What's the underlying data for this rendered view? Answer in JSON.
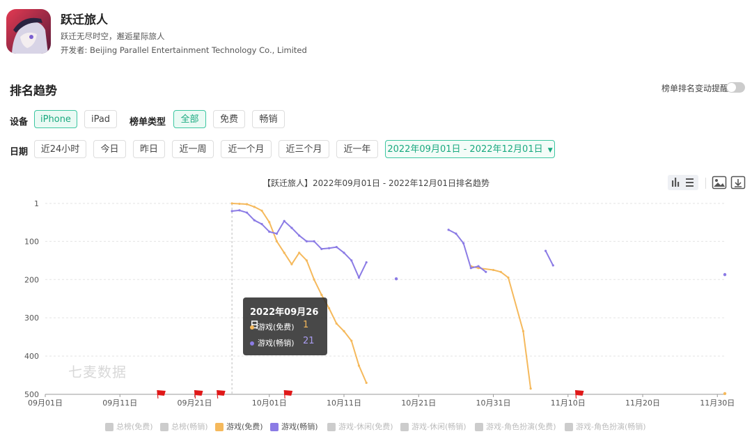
{
  "app": {
    "name": "跃迁旅人",
    "subtitle": "跃迁无尽时空，邂逅星际旅人",
    "developer": "开发者: Beijing Parallel Entertainment Technology Co., Limited"
  },
  "section": {
    "title": "排名趋势",
    "alert_label": "榜单排名变动提醒",
    "alert_on": false
  },
  "filters": {
    "device_label": "设备",
    "devices": [
      {
        "label": "iPhone",
        "active": true
      },
      {
        "label": "iPad",
        "active": false
      }
    ],
    "chart_type_label": "榜单类型",
    "chart_types": [
      {
        "label": "全部",
        "active": true
      },
      {
        "label": "免费",
        "active": false
      },
      {
        "label": "畅销",
        "active": false
      }
    ],
    "date_label": "日期",
    "dates": [
      "近24小时",
      "今日",
      "昨日",
      "近一周",
      "近一个月",
      "近三个月",
      "近一年"
    ],
    "date_range": "2022年09月01日 - 2022年12月01日"
  },
  "toolbar_icons": [
    "bar-chart-icon",
    "list-icon",
    "image-icon",
    "download-icon"
  ],
  "chart_data": {
    "type": "line",
    "title": "【跃迁旅人】2022年09月01日 - 2022年12月01日排名趋势",
    "x_tick_labels": [
      "09月01日",
      "09月11日",
      "09月21日",
      "10月01日",
      "10月11日",
      "10月21日",
      "10月31日",
      "11月10日",
      "11月20日",
      "11月30日"
    ],
    "xlim": [
      "2022-09-01",
      "2022-12-01"
    ],
    "y_tick_labels": [
      "1",
      "100",
      "200",
      "300",
      "400",
      "500"
    ],
    "y_ticks": [
      1,
      100,
      200,
      300,
      400,
      500
    ],
    "ylim": [
      1,
      500
    ],
    "y_inverted": true,
    "grid": true,
    "legend_position": "bottom",
    "series": [
      {
        "name": "游戏(免费)",
        "color": "#f5b95c",
        "segments": [
          [
            [
              "2022-09-26",
              1
            ],
            [
              "2022-09-27",
              2
            ],
            [
              "2022-09-28",
              3
            ],
            [
              "2022-09-29",
              10
            ],
            [
              "2022-09-30",
              20
            ],
            [
              "2022-10-01",
              50
            ],
            [
              "2022-10-02",
              100
            ],
            [
              "2022-10-03",
              130
            ],
            [
              "2022-10-04",
              160
            ],
            [
              "2022-10-05",
              130
            ],
            [
              "2022-10-06",
              150
            ],
            [
              "2022-10-07",
              200
            ],
            [
              "2022-10-08",
              240
            ],
            [
              "2022-10-09",
              275
            ],
            [
              "2022-10-10",
              315
            ],
            [
              "2022-10-11",
              335
            ],
            [
              "2022-10-12",
              360
            ],
            [
              "2022-10-13",
              425
            ],
            [
              "2022-10-14",
              470
            ]
          ],
          [
            [
              "2022-10-28",
              165
            ],
            [
              "2022-10-29",
              170
            ],
            [
              "2022-10-31",
              175
            ],
            [
              "2022-11-01",
              180
            ],
            [
              "2022-11-02",
              195
            ],
            [
              "2022-11-04",
              335
            ],
            [
              "2022-11-05",
              485
            ]
          ],
          [
            [
              "2022-12-01",
              498
            ]
          ]
        ]
      },
      {
        "name": "游戏(畅销)",
        "color": "#8b7be5",
        "segments": [
          [
            [
              "2022-09-26",
              21
            ],
            [
              "2022-09-27",
              19
            ],
            [
              "2022-09-28",
              25
            ],
            [
              "2022-09-29",
              45
            ],
            [
              "2022-09-30",
              55
            ],
            [
              "2022-10-01",
              75
            ],
            [
              "2022-10-02",
              80
            ],
            [
              "2022-10-03",
              47
            ],
            [
              "2022-10-04",
              65
            ],
            [
              "2022-10-05",
              85
            ],
            [
              "2022-10-06",
              100
            ],
            [
              "2022-10-07",
              100
            ],
            [
              "2022-10-08",
              120
            ],
            [
              "2022-10-09",
              118
            ],
            [
              "2022-10-10",
              115
            ],
            [
              "2022-10-11",
              130
            ],
            [
              "2022-10-12",
              150
            ],
            [
              "2022-10-13",
              195
            ],
            [
              "2022-10-14",
              155
            ]
          ],
          [
            [
              "2022-10-18",
              198
            ]
          ],
          [
            [
              "2022-10-25",
              70
            ],
            [
              "2022-10-26",
              80
            ],
            [
              "2022-10-27",
              105
            ],
            [
              "2022-10-28",
              170
            ],
            [
              "2022-10-29",
              165
            ],
            [
              "2022-10-30",
              180
            ]
          ],
          [
            [
              "2022-11-07",
              125
            ],
            [
              "2022-11-08",
              163
            ]
          ],
          [
            [
              "2022-12-01",
              187
            ]
          ]
        ]
      }
    ],
    "flag_dates": [
      "2022-09-16",
      "2022-09-21",
      "2022-09-24",
      "2022-10-03",
      "2022-11-11"
    ],
    "hover_date": "2022-09-26",
    "tooltip": {
      "date": "2022年09月26日",
      "rows": [
        {
          "name": "游戏(免费)",
          "value": "1",
          "color": "#f5b95c"
        },
        {
          "name": "游戏(畅销)",
          "value": "21",
          "color": "#8b7be5"
        }
      ]
    },
    "legend": [
      {
        "name": "总榜(免费)",
        "active": false,
        "color": "#cccccc"
      },
      {
        "name": "总榜(畅销)",
        "active": false,
        "color": "#cccccc"
      },
      {
        "name": "游戏(免费)",
        "active": true,
        "color": "#f5b95c"
      },
      {
        "name": "游戏(畅销)",
        "active": true,
        "color": "#8b7be5"
      },
      {
        "name": "游戏-休闲(免费)",
        "active": false,
        "color": "#cccccc"
      },
      {
        "name": "游戏-休闲(畅销)",
        "active": false,
        "color": "#cccccc"
      },
      {
        "name": "游戏-角色扮演(免费)",
        "active": false,
        "color": "#cccccc"
      },
      {
        "name": "游戏-角色扮演(畅销)",
        "active": false,
        "color": "#cccccc"
      }
    ]
  },
  "watermark": "七麦数据"
}
